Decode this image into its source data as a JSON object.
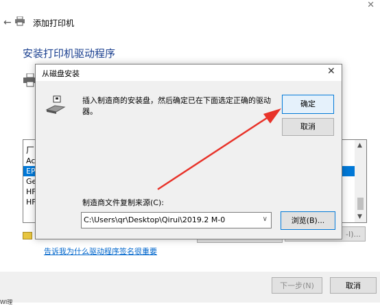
{
  "wizard": {
    "title": "添加打印机",
    "heading": "安装打印机驱动程序",
    "link": "告诉我为什么驱动程序签名很重要",
    "next_button": "下一步(N)",
    "cancel_button": "取消",
    "bottom_partial": "WI理"
  },
  "background_list": {
    "header": "厂",
    "items": [
      "Ac",
      "EP",
      "Ge",
      "HF",
      "HF"
    ],
    "partial_button": "-I)..."
  },
  "dialog": {
    "title": "从磁盘安装",
    "message": "插入制造商的安装盘，然后确定已在下面选定正确的驱动器。",
    "ok_button": "确定",
    "cancel_button": "取消",
    "copy_label": "制造商文件复制来源(C):",
    "path_value": "C:\\Users\\qr\\Desktop\\Qirui\\2019.2 M-0",
    "browse_button": "浏览(B)..."
  },
  "colors": {
    "heading": "#1a3f8f",
    "link": "#0066cc",
    "accent": "#0078d7",
    "selected_row": "#0078d7",
    "arrow": "#e8332a"
  }
}
